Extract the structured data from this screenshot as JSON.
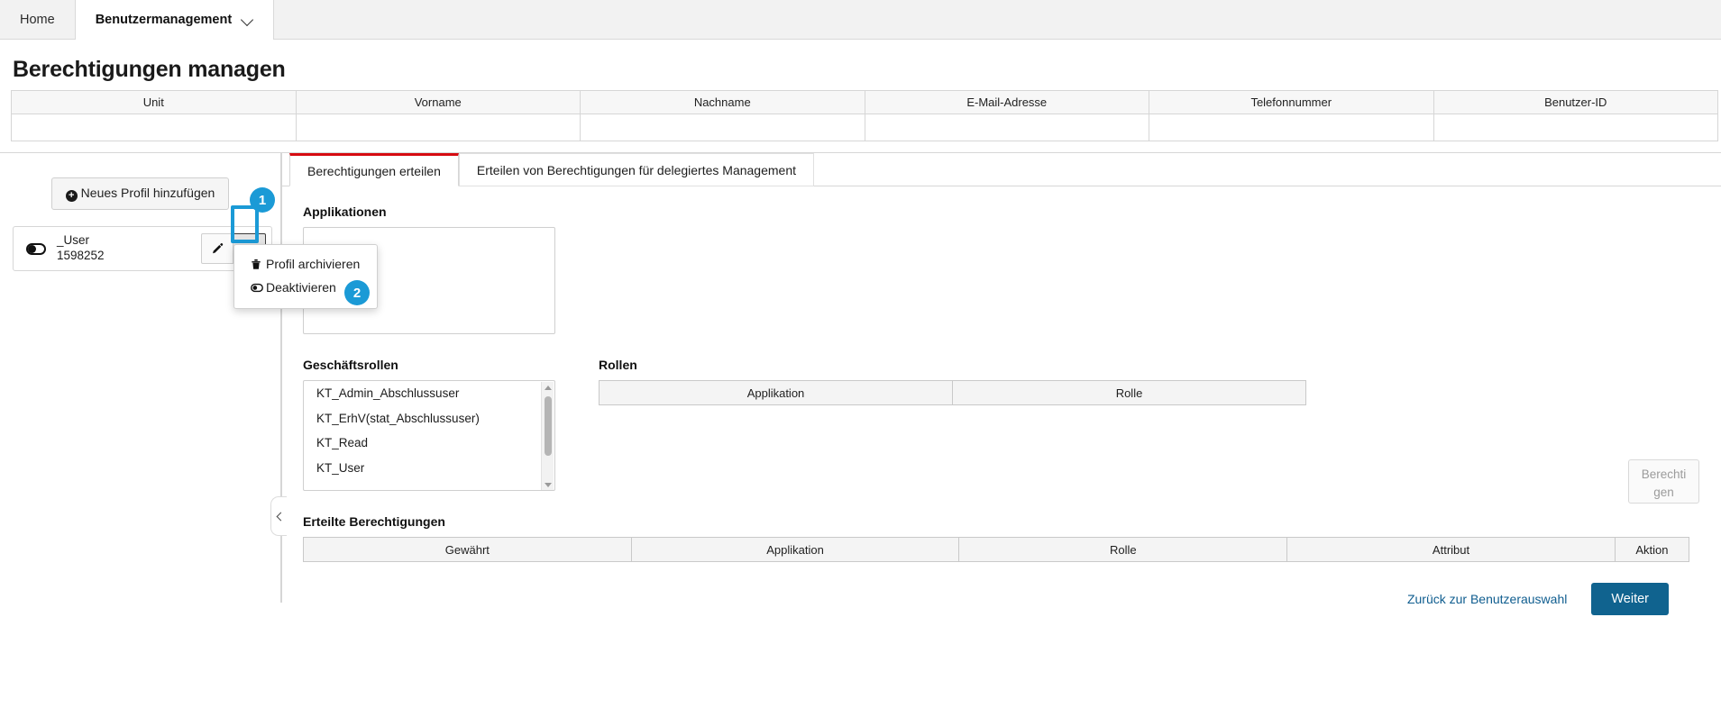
{
  "topnav": {
    "items": [
      {
        "label": "Home",
        "active": false
      },
      {
        "label": "Benutzermanagement",
        "active": true
      }
    ]
  },
  "page": {
    "title": "Berechtigungen managen"
  },
  "user_table": {
    "columns": [
      "Unit",
      "Vorname",
      "Nachname",
      "E-Mail-Adresse",
      "Telefonnummer",
      "Benutzer-ID"
    ],
    "rows": [
      [
        "",
        "",
        "",
        "",
        "",
        ""
      ]
    ]
  },
  "left_panel": {
    "add_profile_label": "Neues Profil hinzufügen",
    "profile": {
      "name": "_User",
      "id": "1598252",
      "edit_tooltip": "Bearbeiten",
      "caret_tooltip": "Menü"
    },
    "dropdown": {
      "items": [
        {
          "label": "Profil archivieren",
          "icon": "trash-icon"
        },
        {
          "label": "Deaktivieren",
          "icon": "toggle-icon"
        }
      ]
    }
  },
  "callouts": [
    {
      "number": "1"
    },
    {
      "number": "2"
    }
  ],
  "tabs": [
    {
      "label": "Berechtigungen erteilen",
      "active": true
    },
    {
      "label": "Erteilen von Berechtigungen für delegiertes Management",
      "active": false
    }
  ],
  "content": {
    "applications": {
      "label": "Applikationen",
      "items": []
    },
    "business_roles": {
      "label": "Geschäftsrollen",
      "items": [
        "KT_Admin_Abschlussuser",
        "KT_ErhV(stat_Abschlussuser)",
        "KT_Read",
        "KT_User"
      ]
    },
    "roles": {
      "label": "Rollen",
      "columns": [
        "Applikation",
        "Rolle"
      ],
      "rows": []
    },
    "authorize_button": {
      "line1": "Berechti",
      "line2": "gen"
    },
    "granted": {
      "label": "Erteilte Berechtigungen",
      "columns": [
        "Gewährt",
        "Applikation",
        "Rolle",
        "Attribut",
        "Aktion"
      ],
      "rows": []
    }
  },
  "footer": {
    "back_link": "Zurück zur Benutzerauswahl",
    "next_button": "Weiter"
  },
  "colors": {
    "accent_red": "#d60b11",
    "highlight_blue": "#1b9ad6",
    "primary_blue": "#10638f"
  }
}
